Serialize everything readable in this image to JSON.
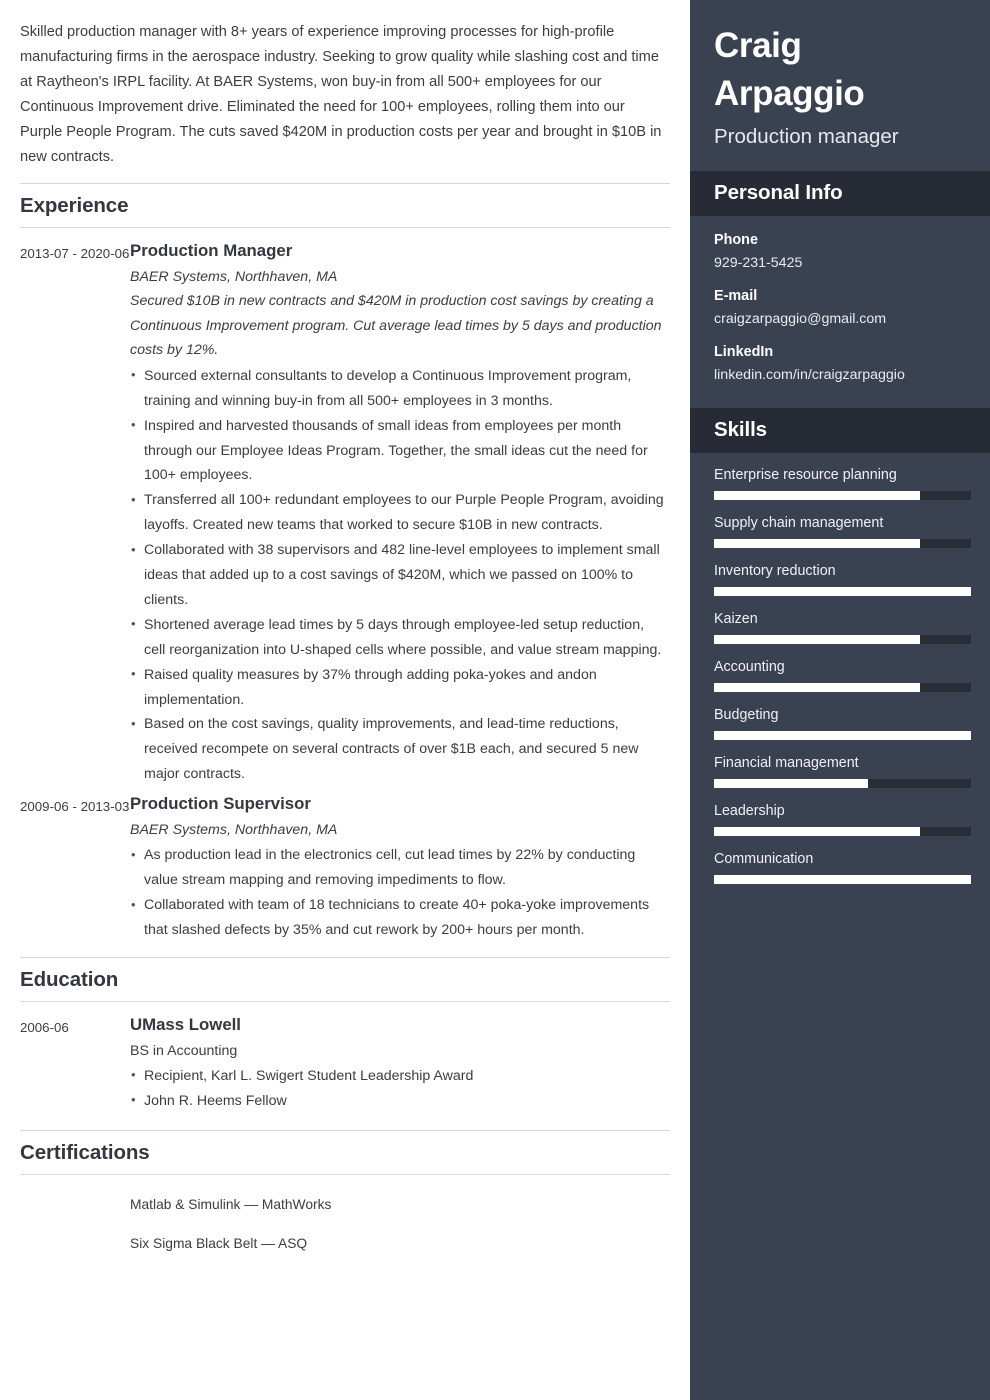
{
  "theme": {
    "sidebar_bg": "#3a4150",
    "sidebar_header_bg": "#272b35",
    "skill_track": "#282d38",
    "skill_fill": "#ffffff",
    "heading_color": "#33373f",
    "body_text": "#3d3d3d",
    "rule_color": "#d8d8d8"
  },
  "summary": {
    "text": "Skilled production manager with 8+ years of experience improving processes for high-profile manufacturing firms in the aerospace industry. Seeking to grow quality while slashing cost and time at Raytheon's IRPL facility. At BAER Systems, won buy-in from all 500+ employees for our Continuous Improvement drive. Eliminated the need for 100+ employees, rolling them into our Purple People Program. The cuts saved $420M in production costs per year and brought in $10B in new contracts."
  },
  "sections": {
    "experience": {
      "title": "Experience",
      "entries": [
        {
          "date": "2013-07 - 2020-06",
          "title": "Production Manager",
          "subtitle": "BAER Systems, Northhaven, MA",
          "description": "Secured $10B in new contracts and $420M in production cost savings by creating a Continuous Improvement program. Cut average lead times by 5 days and production costs by 12%.",
          "bullets": [
            "Sourced external consultants to develop a Continuous Improvement program, training and winning buy-in from all 500+ employees in 3 months.",
            "Inspired and harvested thousands of small ideas from employees per month through our Employee Ideas Program. Together, the small ideas cut the need for 100+ employees.",
            "Transferred all 100+ redundant employees to our Purple People Program, avoiding layoffs. Created new teams that worked to secure $10B in new contracts.",
            "Collaborated with 38 supervisors and 482 line-level employees to implement small ideas that added up to a cost savings of $420M, which we passed on 100% to clients.",
            "Shortened average lead times by 5 days through employee-led setup reduction, cell reorganization into U-shaped cells where possible, and value stream mapping.",
            "Raised quality measures by 37% through adding poka-yokes and andon implementation.",
            "Based on the cost savings, quality improvements, and lead-time reductions, received recompete on several contracts of over $1B each, and secured 5 new major contracts."
          ]
        },
        {
          "date": "2009-06 - 2013-03",
          "title": "Production Supervisor",
          "subtitle": "BAER Systems, Northhaven, MA",
          "description": "",
          "bullets": [
            "As production lead in the electronics cell, cut lead times by 22% by conducting value stream mapping and removing impediments to flow.",
            "Collaborated with team of 18 technicians to create 40+ poka-yoke improvements that slashed defects by 35% and cut rework by 200+ hours per month."
          ]
        }
      ]
    },
    "education": {
      "title": "Education",
      "entries": [
        {
          "date": "2006-06",
          "title": "UMass Lowell",
          "subtitle": "BS in Accounting",
          "bullets": [
            "Recipient, Karl L. Swigert Student Leadership Award",
            "John R. Heems Fellow"
          ]
        }
      ]
    },
    "certifications": {
      "title": "Certifications",
      "items": [
        "Matlab & Simulink — MathWorks",
        "Six Sigma Black Belt — ASQ"
      ]
    }
  },
  "sidebar": {
    "first_name": "Craig",
    "last_name": "Arpaggio",
    "job_title": "Production manager",
    "personal_info": {
      "title": "Personal Info",
      "items": [
        {
          "label": "Phone",
          "value": "929-231-5425"
        },
        {
          "label": "E-mail",
          "value": "craigzarpaggio@gmail.com"
        },
        {
          "label": "LinkedIn",
          "value": "linkedin.com/in/craigzarpaggio"
        }
      ]
    },
    "skills": {
      "title": "Skills",
      "items": [
        {
          "name": "Enterprise resource planning",
          "level": 80
        },
        {
          "name": "Supply chain management",
          "level": 80
        },
        {
          "name": "Inventory reduction",
          "level": 100
        },
        {
          "name": "Kaizen",
          "level": 80
        },
        {
          "name": "Accounting",
          "level": 80
        },
        {
          "name": "Budgeting",
          "level": 100
        },
        {
          "name": "Financial management",
          "level": 60
        },
        {
          "name": "Leadership",
          "level": 80
        },
        {
          "name": "Communication",
          "level": 100
        }
      ]
    }
  }
}
